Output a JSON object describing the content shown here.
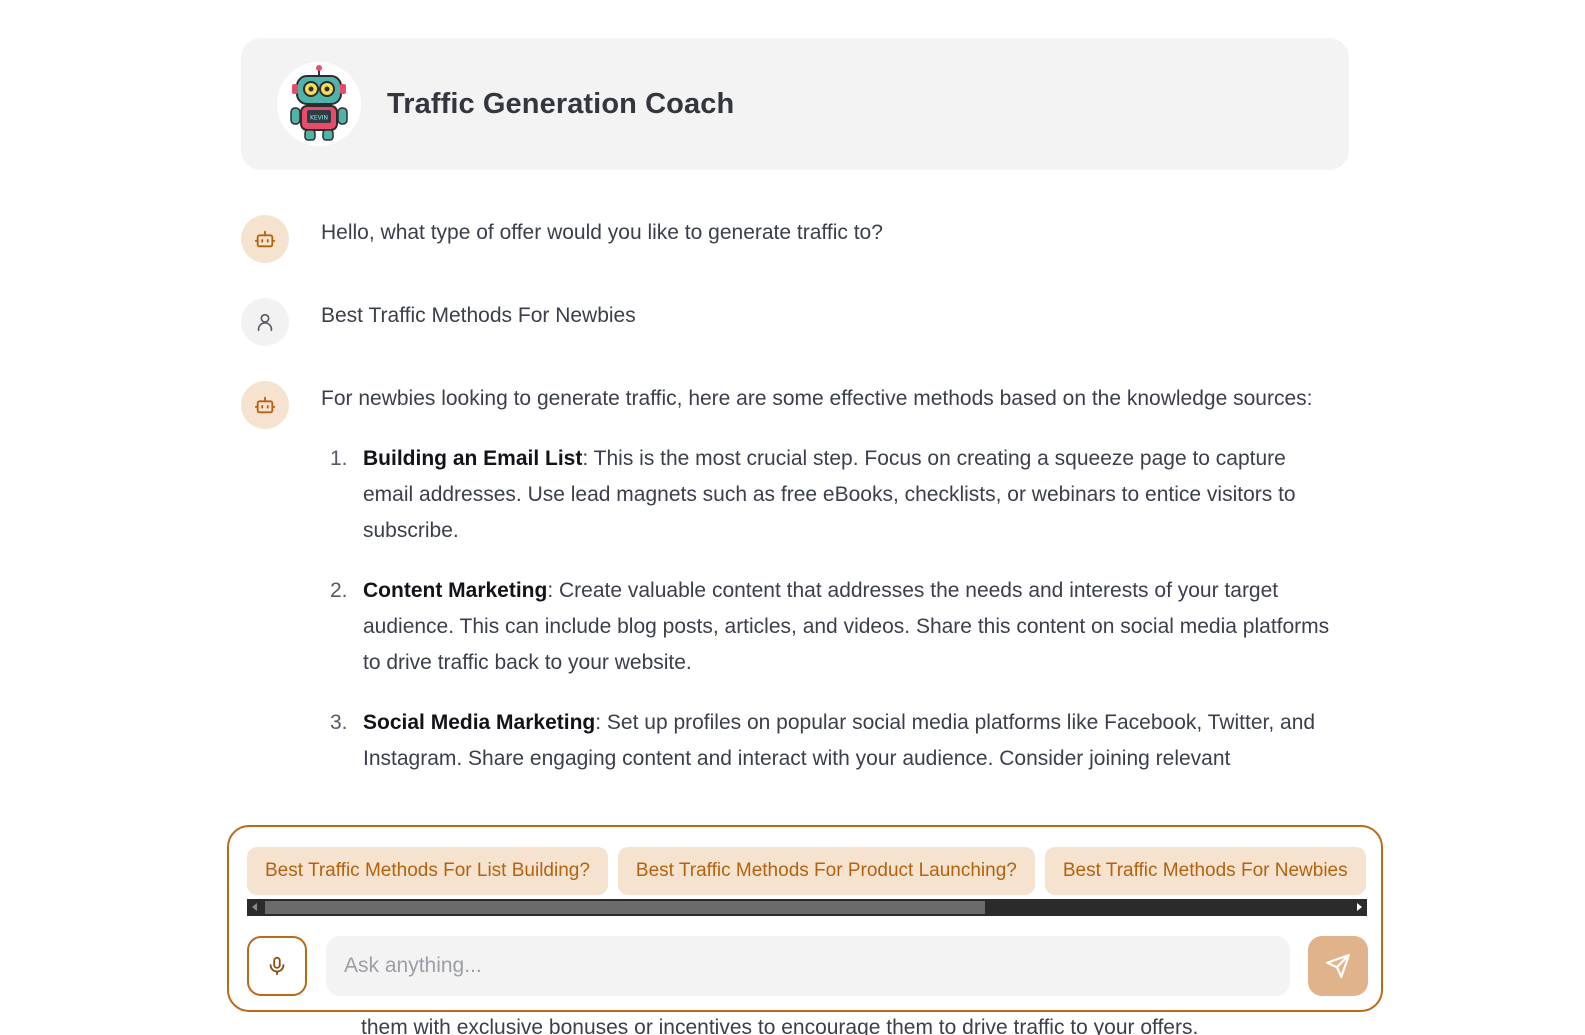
{
  "header": {
    "title": "Traffic Generation Coach",
    "avatar_icon": "robot-mascot-icon",
    "avatar_badge_text": "KEVIN"
  },
  "messages": [
    {
      "role": "bot",
      "icon": "bot-icon",
      "text": "Hello, what type of offer would you like to generate traffic to?"
    },
    {
      "role": "user",
      "icon": "user-icon",
      "text": "Best Traffic Methods For Newbies"
    },
    {
      "role": "bot",
      "icon": "bot-icon",
      "intro": "For newbies looking to generate traffic, here are some effective methods based on the knowledge sources:",
      "points": [
        {
          "num": "1.",
          "title": "Building an Email List",
          "body": ": This is the most crucial step. Focus on creating a squeeze page to capture email addresses. Use lead magnets such as free eBooks, checklists, or webinars to entice visitors to subscribe."
        },
        {
          "num": "2.",
          "title": "Content Marketing",
          "body": ": Create valuable content that addresses the needs and interests of your target audience. This can include blog posts, articles, and videos. Share this content on social media platforms to drive traffic back to your website."
        },
        {
          "num": "3.",
          "title": "Social Media Marketing",
          "body": ": Set up profiles on popular social media platforms like Facebook, Twitter, and Instagram. Share engaging content and interact with your audience. Consider joining relevant"
        }
      ],
      "partial_line": "them with exclusive bonuses or incentives to encourage them to drive traffic to your offers."
    }
  ],
  "suggestions": [
    "Best Traffic Methods For List Building?",
    "Best Traffic Methods For Product Launching?",
    "Best Traffic Methods For Newbies"
  ],
  "composer": {
    "placeholder": "Ask anything...",
    "mic_icon": "microphone-icon",
    "send_icon": "send-icon"
  },
  "colors": {
    "accent": "#b96a19",
    "chip_bg": "#f6e3cf",
    "send_bg": "#e0b38a",
    "header_bg": "#f3f3f3"
  }
}
